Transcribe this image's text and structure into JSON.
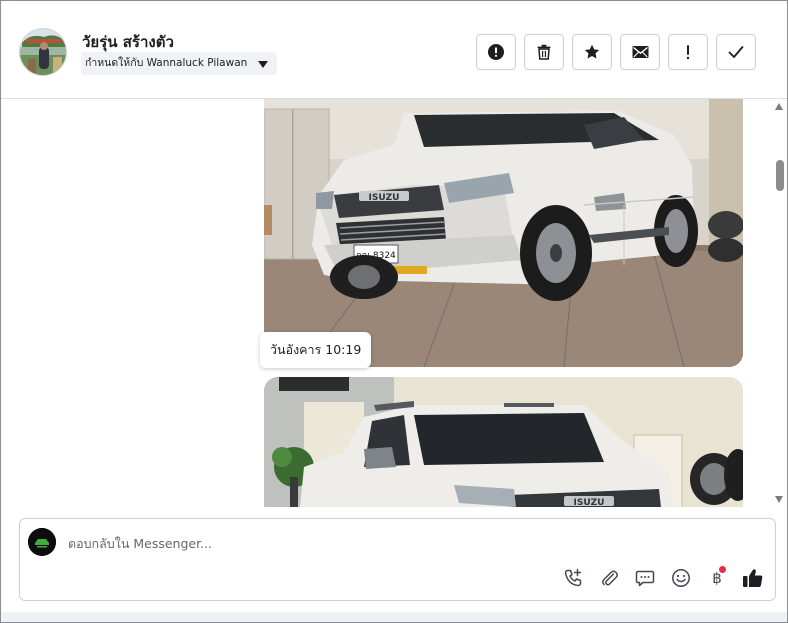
{
  "header": {
    "contact_name": "วัยรุ่น สร้างตัว",
    "assign_label": "กำหนดให้กับ Wannaluck Pilawan",
    "actions": [
      {
        "name": "report-spam-button",
        "icon": "exclamation-circle-icon"
      },
      {
        "name": "delete-button",
        "icon": "trash-icon"
      },
      {
        "name": "star-button",
        "icon": "star-icon"
      },
      {
        "name": "mark-unread-button",
        "icon": "envelope-icon"
      },
      {
        "name": "follow-up-button",
        "icon": "exclamation-icon"
      },
      {
        "name": "mark-done-button",
        "icon": "check-icon"
      }
    ]
  },
  "messages": {
    "timestamp": "วันอังคาร 10:19",
    "photo1_plate": "กณ 8324",
    "photo1_badge": "ISUZU",
    "photo2_badge": "ISUZU"
  },
  "composer": {
    "placeholder": "ตอบกลับใน Messenger...",
    "actions": [
      {
        "name": "call-button",
        "icon": "phone-plus-icon"
      },
      {
        "name": "attach-button",
        "icon": "paperclip-icon"
      },
      {
        "name": "saved-replies-button",
        "icon": "chat-bubble-icon"
      },
      {
        "name": "emoji-button",
        "icon": "smiley-icon"
      },
      {
        "name": "payment-button",
        "icon": "baht-icon",
        "label": "฿"
      },
      {
        "name": "like-button",
        "icon": "thumbs-up-icon"
      }
    ]
  },
  "colors": {
    "border": "#ccd0d5",
    "icon": "#444950",
    "notification_dot": "#f02849",
    "placeholder": "#606770"
  }
}
